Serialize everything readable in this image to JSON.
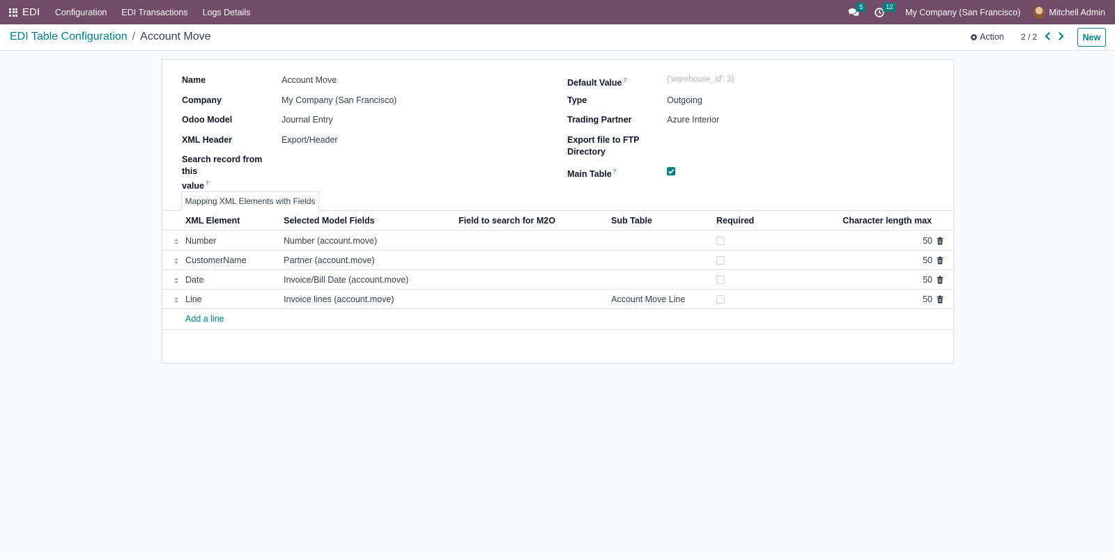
{
  "navbar": {
    "brand": "EDI",
    "menu": [
      "Configuration",
      "EDI Transactions",
      "Logs Details"
    ],
    "messages_count": "5",
    "activities_count": "12",
    "company": "My Company (San Francisco)",
    "user": "Mitchell Admin"
  },
  "control": {
    "breadcrumb_parent": "EDI Table Configuration",
    "breadcrumb_separator": "/",
    "breadcrumb_current": "Account Move",
    "action_label": "Action",
    "pager": "2 / 2",
    "new_label": "New"
  },
  "form": {
    "left": [
      {
        "label": "Name",
        "value": "Account Move"
      },
      {
        "label": "Company",
        "value": "My Company (San Francisco)"
      },
      {
        "label": "Odoo Model",
        "value": "Journal Entry"
      },
      {
        "label": "XML Header",
        "value": "Export/Header"
      },
      {
        "label": "Search record from this value",
        "label_line1": "Search record from this",
        "label_line2": "value",
        "value": ""
      }
    ],
    "right": [
      {
        "label": "Default Value",
        "placeholder": "{'warehouse_id': 3}"
      },
      {
        "label": "Type",
        "value": "Outgoing"
      },
      {
        "label": "Trading Partner",
        "value": "Azure Interior"
      },
      {
        "label": "Export file to FTP Directory",
        "label_line1": "Export file to FTP",
        "label_line2": "Directory",
        "value": ""
      },
      {
        "label": "Main Table",
        "checked": true
      }
    ],
    "help_mark": "?"
  },
  "tabs": [
    {
      "label": "Mapping XML Elements with Fields",
      "active": true
    }
  ],
  "table": {
    "columns": [
      "XML Element",
      "Selected Model Fields",
      "Field to search for M2O",
      "Sub Table",
      "Required",
      "Character length max"
    ],
    "rows": [
      {
        "xml_element": "Number",
        "model_field": "Number (account.move)",
        "m2o": "",
        "sub_table": "",
        "required": false,
        "max_len": "50"
      },
      {
        "xml_element": "CustomerName",
        "model_field": "Partner (account.move)",
        "m2o": "",
        "sub_table": "",
        "required": false,
        "max_len": "50"
      },
      {
        "xml_element": "Date",
        "model_field": "Invoice/Bill Date (account.move)",
        "m2o": "",
        "sub_table": "",
        "required": false,
        "max_len": "50"
      },
      {
        "xml_element": "Line",
        "model_field": "Invoice lines (account.move)",
        "m2o": "",
        "sub_table": "Account Move Line",
        "required": false,
        "max_len": "50"
      }
    ],
    "add_line": "Add a line"
  },
  "colors": {
    "navbar": "#714b67",
    "accent": "#017e84"
  }
}
